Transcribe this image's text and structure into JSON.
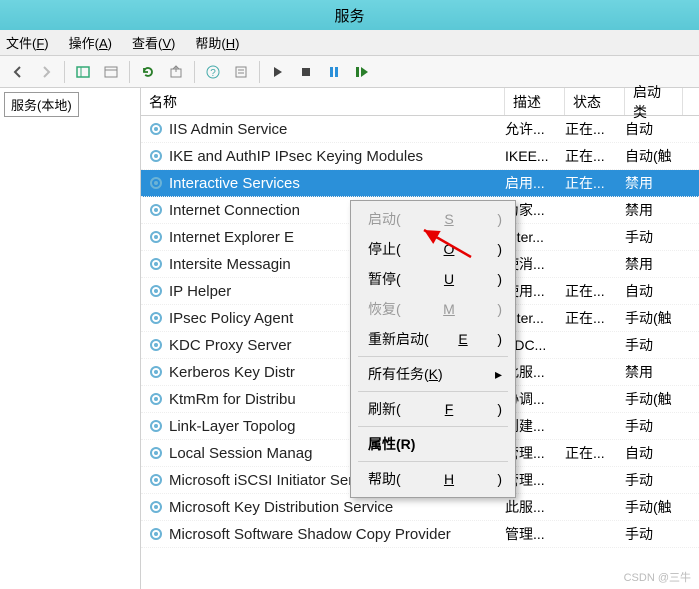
{
  "window": {
    "title": "服务"
  },
  "menu": {
    "file": "文件(F)",
    "action": "操作(A)",
    "view": "查看(V)",
    "help": "帮助(H)"
  },
  "toolbar_icons": [
    "back",
    "forward",
    "up",
    "detail",
    "refresh",
    "export",
    "help",
    "props",
    "play",
    "stop",
    "pause",
    "restart"
  ],
  "tree": {
    "root": "服务(本地)"
  },
  "columns": {
    "name": "名称",
    "desc": "描述",
    "status": "状态",
    "startup": "启动类"
  },
  "services": [
    {
      "name": "IIS Admin Service",
      "desc": "允许...",
      "status": "正在...",
      "startup": "自动"
    },
    {
      "name": "IKE and AuthIP IPsec Keying Modules",
      "desc": "IKEE...",
      "status": "正在...",
      "startup": "自动(触"
    },
    {
      "name": "Interactive Services",
      "desc": "启用...",
      "status": "正在...",
      "startup": "禁用",
      "selected": true
    },
    {
      "name": "Internet Connection",
      "desc": "为家...",
      "status": "",
      "startup": "禁用"
    },
    {
      "name": "Internet Explorer E",
      "desc": "Inter...",
      "status": "",
      "startup": "手动"
    },
    {
      "name": "Intersite Messagin",
      "desc": "使消...",
      "status": "",
      "startup": "禁用"
    },
    {
      "name": "IP Helper",
      "desc": "使用...",
      "status": "正在...",
      "startup": "自动"
    },
    {
      "name": "IPsec Policy Agent",
      "desc": "Inter...",
      "status": "正在...",
      "startup": "手动(触"
    },
    {
      "name": "KDC Proxy Server",
      "desc": "KDC...",
      "status": "",
      "startup": "手动"
    },
    {
      "name": "Kerberos Key Distr",
      "desc": "此服...",
      "status": "",
      "startup": "禁用"
    },
    {
      "name": "KtmRm for Distribu",
      "desc": "协调...",
      "status": "",
      "startup": "手动(触"
    },
    {
      "name": "Link-Layer Topolog",
      "desc": "创建...",
      "status": "",
      "startup": "手动"
    },
    {
      "name": "Local Session Manag",
      "desc": "管理...",
      "status": "正在...",
      "startup": "自动"
    },
    {
      "name": "Microsoft iSCSI Initiator Service",
      "desc": "管理...",
      "status": "",
      "startup": "手动"
    },
    {
      "name": "Microsoft Key Distribution Service",
      "desc": "此服...",
      "status": "",
      "startup": "手动(触"
    },
    {
      "name": "Microsoft Software Shadow Copy Provider",
      "desc": "管理...",
      "status": "",
      "startup": "手动"
    }
  ],
  "context_menu": {
    "start": "启动(S)",
    "stop": "停止(O)",
    "pause": "暂停(U)",
    "resume": "恢复(M)",
    "restart": "重新启动(E)",
    "alltasks": "所有任务(K)",
    "refresh": "刷新(F)",
    "properties": "属性(R)",
    "help": "帮助(H)"
  },
  "watermark": "CSDN @三牛"
}
